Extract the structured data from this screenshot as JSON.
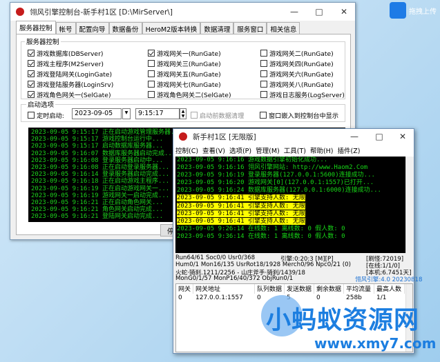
{
  "main_window": {
    "title": "翎风引擎控制台-新手村1区 [D:\\MirServer\\]",
    "tabs": [
      "服务器控制",
      "帐号",
      "配置向导",
      "数据备份",
      "HeroM2版本转换",
      "数据清理",
      "服务窗口",
      "相关信息"
    ],
    "group_server": "服务器控制",
    "checkboxes": [
      {
        "label": "游戏数据库(DBServer)",
        "checked": true
      },
      {
        "label": "游戏主程序(M2Server)",
        "checked": true
      },
      {
        "label": "游戏登陆网关(LoginGate)",
        "checked": true
      },
      {
        "label": "游戏登陆服务器(LoginSrv)",
        "checked": true
      },
      {
        "label": "游戏角色网关一(SelGate)",
        "checked": true
      },
      {
        "label": "游戏网关一(RunGate)",
        "checked": true
      },
      {
        "label": "游戏网关三(RunGate)",
        "checked": false
      },
      {
        "label": "游戏网关五(RunGate)",
        "checked": false
      },
      {
        "label": "游戏网关七(RunGate)",
        "checked": false
      },
      {
        "label": "游戏角色网关二(SelGate)",
        "checked": false
      },
      {
        "label": "游戏网关二(RunGate)",
        "checked": false
      },
      {
        "label": "游戏网关四(RunGate)",
        "checked": false
      },
      {
        "label": "游戏网关六(RunGate)",
        "checked": false
      },
      {
        "label": "游戏网关八(RunGate)",
        "checked": false
      },
      {
        "label": "游戏日志服务(LogServer)",
        "checked": false
      }
    ],
    "group_start": "启动选项",
    "timed_start_label": "定时启动:",
    "date_value": "2023-09-05",
    "time_value": "9:15:17",
    "pre_clean_label": "启动前数据清理",
    "embed_label": "窗口嵌入到控制台中显示",
    "stop_button": "停止",
    "console_lines": [
      "2023-09-05 9:15:17 正在启动游戏管理服务器...",
      "2023-09-05 9:15:17 游戏控制台运行中...",
      "2023-09-05 9:15:17 启动数据库服务器...",
      "2023-09-05 9:16:07 数据库服务器启动完成...",
      "2023-09-05 9:16:08 登录服务器启动中...",
      "2023-09-05 9:16:08 正在启动登录服务器...",
      "2023-09-05 9:16:14 登录服务器启动完成...",
      "2023-09-05 9:16:18 正在启动游戏主程序...",
      "2023-09-05 9:16:19 正在启动游戏网关一...",
      "2023-09-05 9:16:19 游戏网关一启动完成...",
      "2023-09-05 9:16:21 正在启动角色网关...",
      "2023-09-05 9:16:21 角色网关启动完成...",
      "2023-09-05 9:16:21 登陆网关启动完成..."
    ]
  },
  "second_window": {
    "title": "新手村1区 [无限版]",
    "menu": [
      "控制(C)",
      "查看(V)",
      "选项(P)",
      "管理(M)",
      "工具(T)",
      "帮助(H)",
      "插件(Z)"
    ],
    "console_lines": [
      {
        "text": "2023-09-05 9:16:16 游戏数据引擎初始化成功...",
        "hl": false
      },
      {
        "text": "2023-09-05 9:16:16 翎风引擎网站: http://www.Haom2.Com",
        "hl": false
      },
      {
        "text": "2023-09-05 9:16:19 登录服务器(127.0.0.1:5600)连接成功...",
        "hl": false
      },
      {
        "text": "2023-09-05 9:16:20 游戏网关[0](127.0.0.1:1557)已打开...",
        "hl": false
      },
      {
        "text": "2023-09-05 9:16:24 数据库服务器(127.0.0.1:6000)连接成功...",
        "hl": false
      },
      {
        "text": "2023-09-05 9:16:41 引擎支持人数: 无限",
        "hl": true
      },
      {
        "text": "2023-09-05 9:16:41 引擎支持人数: 无限",
        "hl": true
      },
      {
        "text": "2023-09-05 9:16:41 引擎支持人数: 无限",
        "hl": true
      },
      {
        "text": "2023-09-05 9:16:41 引擎支持人数: 无限",
        "hl": true
      },
      {
        "text": "2023-09-05 9:26:14 在线数: 1 离线数: 0 假人数: 0",
        "hl": false
      },
      {
        "text": "2023-09-05 9:36:14 在线数: 1 离线数: 0 假人数: 0",
        "hl": false
      }
    ],
    "status_rows": [
      {
        "left": "Run64/61 Soc0/0 Usr0/368",
        "mid": "引擎:0:20:3 [M][P]",
        "right": "[刷怪:72019]"
      },
      {
        "left": "Hum0/1 Mon16/135 UsrRot18/1928 Merch0/96 Npc0/21 (0)",
        "mid": "",
        "right": "[在线:1/1/0]"
      },
      {
        "left": "火蛇·骑刹.1211/2256 - 山庄斧手·骑刹/1439/18",
        "mid": "",
        "right": "[本机:6.7451天]"
      },
      {
        "left": "MonG0/1/57 MonP16/40/372 ObjRun0/1",
        "mid": "",
        "right": "翎风引擎:4.0 20230818"
      }
    ],
    "table_headers": [
      "网关",
      "网关地址",
      "队列数据",
      "发送数据",
      "剩余数据",
      "平均流量",
      "最高人数"
    ],
    "table_row": [
      "0",
      "127.0.0.1:1557",
      "0",
      "5",
      "0",
      "258b",
      "1/1"
    ]
  },
  "desktop": {
    "upload_label": "拖拽上传",
    "watermark": "小蚂蚁资源网",
    "watermark_url": "www.xmy7.com"
  }
}
